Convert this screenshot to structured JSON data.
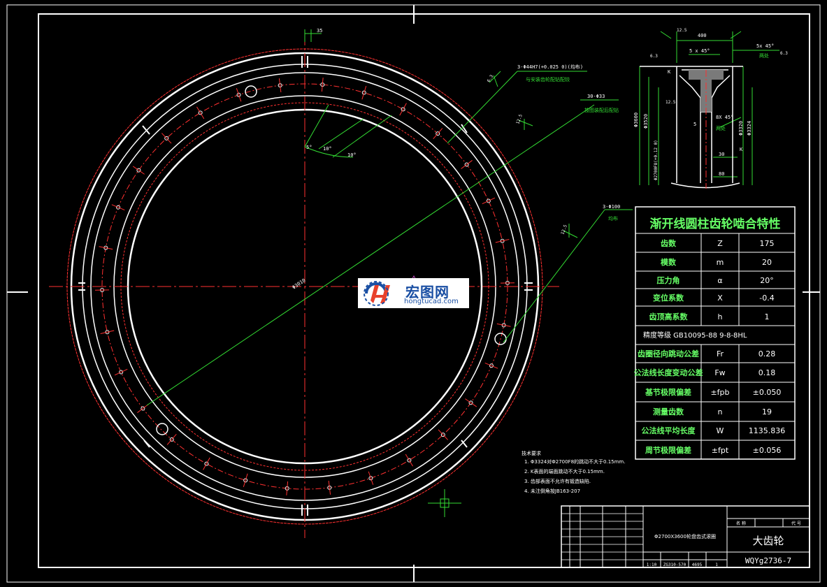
{
  "drawing": {
    "colors": {
      "background": "#000000",
      "outline": "#ffffff",
      "centerline": "#ff3030",
      "dimension": "#33dd33",
      "table_text": "#ffffff",
      "table_header": "#66ff66",
      "watermark_blue": "#1a4fa3"
    }
  },
  "callouts": {
    "top_dim": "35",
    "hole_3_spec": "3-Φ44H7(+0.025 0)(均布)",
    "hole_3_note": "与安装齿轮配钻配铰",
    "hole_30": "30-Φ33",
    "hole_30_note": "按图装配后配钻",
    "hole_3_100": "3-Φ100",
    "hole_3_100_note": "均布",
    "angle_5": "5°",
    "angle_10a": "10°",
    "angle_10b": "10°",
    "diameter_main": "Φ3010",
    "roughness_1": "6.3",
    "roughness_2": "12.5",
    "roughness_3": "12.5"
  },
  "section": {
    "dim_width": "400",
    "dim_chamfer_top": "5 x 45°",
    "dim_chamfer_right": "5x 45°",
    "chamfer_note": "两处",
    "dim_chamfer_mid": "8X 45°",
    "chamfer_note_mid": "两处",
    "dim_left_1": "Φ3600",
    "dim_left_2": "Φ3520",
    "dim_left_3": "Φ2700F8(+0.12 0)",
    "dim_right_1": "Φ3320",
    "dim_right_2": "Φ3324",
    "dim_30": "30",
    "dim_80": "80",
    "dim_5": "5",
    "label_k1": "K",
    "label_k2": "K",
    "rough_a": "6.3",
    "rough_b": "12.5",
    "rough_c": "6.3",
    "rough_d": "12.5"
  },
  "gear_table": {
    "title": "渐开线圆柱齿轮啮合特性",
    "rows": [
      {
        "label": "齿数",
        "symbol": "Z",
        "value": "175"
      },
      {
        "label": "模数",
        "symbol": "m",
        "value": "20"
      },
      {
        "label": "压力角",
        "symbol": "α",
        "value": "20°"
      },
      {
        "label": "变位系数",
        "symbol": "X",
        "value": "-0.4"
      },
      {
        "label": "齿顶高系数",
        "symbol": "h",
        "value": "1"
      }
    ],
    "accuracy": "精度等级  GB10095-88  9-8-8HL",
    "rows2": [
      {
        "label": "齿圈径向跳动公差",
        "symbol": "Fr",
        "value": "0.28"
      },
      {
        "label": "公法线长度变动公差",
        "symbol": "Fw",
        "value": "0.18"
      },
      {
        "label": "基节极限偏差",
        "symbol": "±fpb",
        "value": "±0.050"
      },
      {
        "label": "测量齿数",
        "symbol": "n",
        "value": "19"
      },
      {
        "label": "公法线平均长度",
        "symbol": "W",
        "value": "1135.836"
      },
      {
        "label": "周节极限偏差",
        "symbol": "±fpt",
        "value": "±0.056"
      }
    ]
  },
  "notes": {
    "title": "技术要求",
    "items": [
      "1. Φ3324对Φ2700F8的跳动不大于0.15mm.",
      "2. K表面的端面跳动不大于0.15mm.",
      "3. 齿部表面不允许有锻造缺陷.",
      "4. 未注倒角按JB163-207"
    ]
  },
  "title_block": {
    "project": "Φ2700X3600轮盘齿式滚圈",
    "part_name": "大齿轮",
    "drawing_no": "WQYg2736-7",
    "scale": "1:10",
    "material": "ZG310-570",
    "weight": "4695",
    "qty": "1",
    "hdr_a": "名 称",
    "hdr_b": "代 号"
  },
  "watermark": {
    "brand": "宏图网",
    "url": "hongtucad.com"
  }
}
